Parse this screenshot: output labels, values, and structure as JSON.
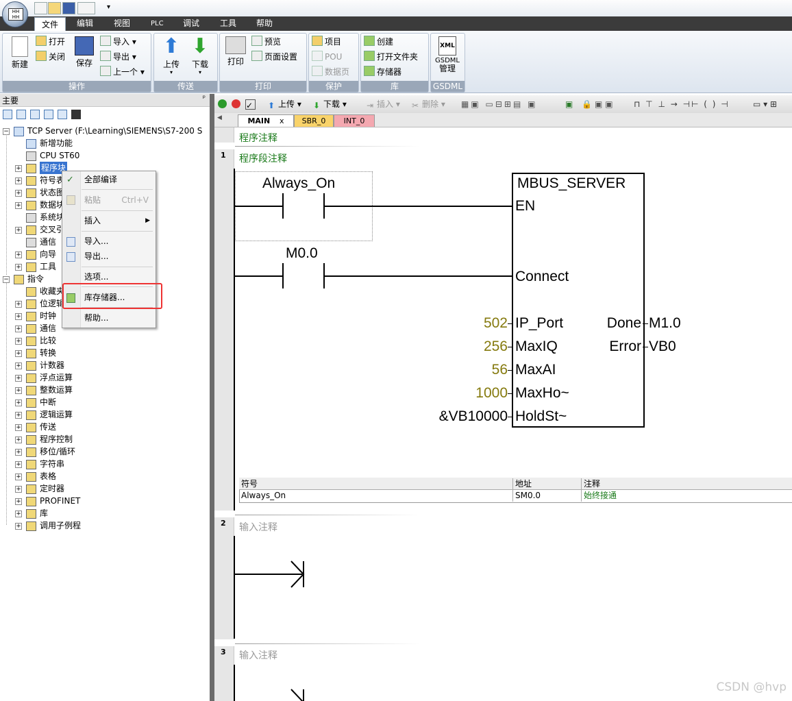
{
  "menu": [
    "文件",
    "编辑",
    "视图",
    "PLC",
    "调试",
    "工具",
    "帮助"
  ],
  "ribbon": {
    "groups": {
      "operation": "操作",
      "transfer": "传送",
      "print": "打印",
      "protect": "保护",
      "library": "库",
      "gsdml": "GSDML"
    },
    "new": "新建",
    "open": "打开",
    "close": "关闭",
    "save": "保存",
    "import": "导入",
    "export": "导出",
    "previous": "上一个",
    "upload": "上传",
    "download": "下载",
    "print_btn": "打印",
    "preview": "预览",
    "page_setup": "页面设置",
    "project": "项目",
    "pou": "POU",
    "datapage": "数据页",
    "create": "创建",
    "open_folder": "打开文件夹",
    "memory": "存储器",
    "gsdml_xml": "XML",
    "gsdml_label": "GSDML",
    "gsdml_manage": "管理"
  },
  "left_panel": {
    "title": "主要",
    "pin": "ᵖ",
    "tree_root": "TCP Server (F:\\Learning\\SIEMENS\\S7-200 S",
    "items": [
      "新增功能",
      "CPU ST60",
      "程序块",
      "符号表",
      "状态图",
      "数据块",
      "系统块",
      "交叉引",
      "通信",
      "向导",
      "工具",
      "指令",
      "收藏夹",
      "位逻辑",
      "时钟",
      "通信",
      "比较",
      "转换",
      "计数器",
      "浮点运算",
      "整数运算",
      "中断",
      "逻辑运算",
      "传送",
      "程序控制",
      "移位/循环",
      "字符串",
      "表格",
      "定时器",
      "PROFINET",
      "库",
      "调用子例程"
    ]
  },
  "context_menu": {
    "compile_all": "全部编译",
    "paste": "粘贴",
    "paste_shortcut": "Ctrl+V",
    "insert": "插入",
    "import": "导入...",
    "export": "导出...",
    "options": "选项...",
    "library_memory": "库存储器...",
    "help": "帮助..."
  },
  "editor_toolbar": {
    "upload": "上传",
    "download": "下载",
    "insert": "插入",
    "delete": "删除"
  },
  "tabs": [
    "MAIN",
    "SBR_0",
    "INT_0"
  ],
  "tab_close": "x",
  "program": {
    "program_comment": "程序注释",
    "networks": [
      {
        "number": "1",
        "comment": "程序段注释"
      },
      {
        "number": "2",
        "comment": "输入注释"
      },
      {
        "number": "3",
        "comment": "输入注释"
      }
    ],
    "contact1": "Always_On",
    "contact2": "M0.0",
    "block_name": "MBUS_SERVER",
    "pins_left": [
      "EN",
      "Connect",
      "IP_Port",
      "MaxIQ",
      "MaxAI",
      "MaxHo~",
      "HoldSt~"
    ],
    "pin_values": [
      "502",
      "256",
      "56",
      "1000",
      "&VB10000"
    ],
    "pins_right": [
      "Done",
      "Error"
    ],
    "outputs": [
      "M1.0",
      "VB0"
    ],
    "symbol_table": {
      "headers": [
        "符号",
        "地址",
        "注释"
      ],
      "rows": [
        [
          "Always_On",
          "SM0.0",
          "始终接通"
        ]
      ]
    }
  },
  "watermark": "CSDN @hvp",
  "colors": {
    "menubar": "#3b3b3b",
    "selection": "#3874d0",
    "highlight_box": "#e33333",
    "comment_green": "#1a7a1a",
    "value_gold": "#857a0e"
  }
}
